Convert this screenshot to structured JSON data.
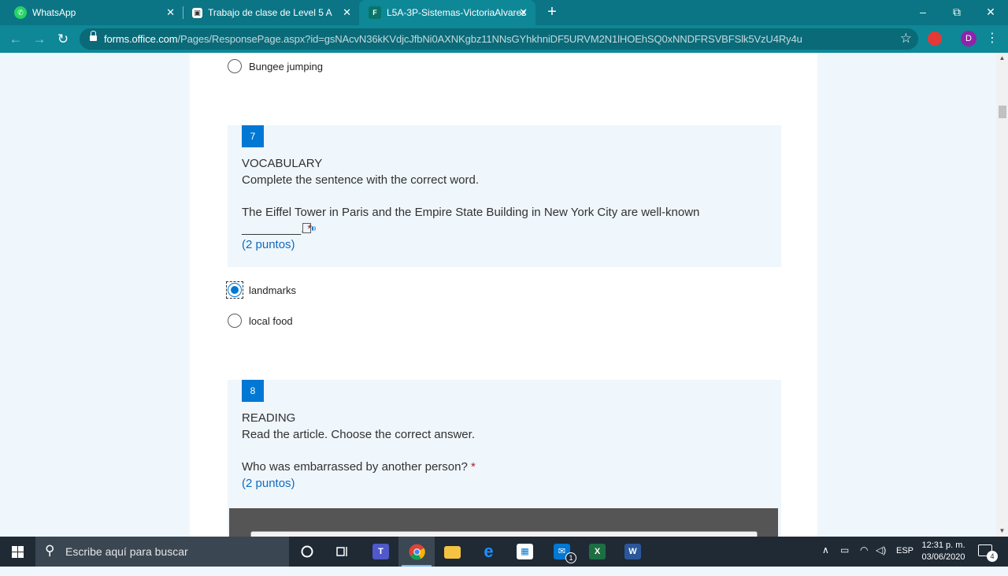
{
  "browser": {
    "tabs": [
      {
        "title": "WhatsApp",
        "icon": "whatsapp-icon"
      },
      {
        "title": "Trabajo de clase de Level 5 A",
        "icon": "classroom-icon"
      },
      {
        "title": "L5A-3P-Sistemas-VictoriaAlvarez",
        "icon": "forms-icon",
        "active": true
      }
    ],
    "new_tab": "+",
    "window": {
      "minimize": "–",
      "restore": "⧉",
      "close": "✕"
    },
    "url_domain": "forms.office.com",
    "url_path": "/Pages/ResponsePage.aspx?id=gsNAcvN36kKVdjcJfbNi0AXNKgbz11NNsGYhkhniDF5URVM2N1lHOEhSQ0xNNDFRSVBFSlk5VzU4Ry4u",
    "profile_initial": "D"
  },
  "form": {
    "prev_option": "Bungee jumping",
    "q7": {
      "number": "7",
      "section": "VOCABULARY",
      "instruction": "Complete the sentence with the correct word.",
      "sentence": "The Eiffel Tower in Paris and the Empire State Building in New York City are well-known",
      "blank": "_________.",
      "required_mark": "*",
      "points": "(2 puntos)",
      "options": [
        {
          "label": "landmarks",
          "checked": true
        },
        {
          "label": "local food",
          "checked": false
        }
      ]
    },
    "q8": {
      "number": "8",
      "section": "READING",
      "instruction": "Read the article. Choose the correct answer.",
      "question": "Who was embarrassed by another person?",
      "required_mark": "*",
      "points": "(2 puntos)"
    }
  },
  "taskbar": {
    "search_placeholder": "Escribe aquí para buscar",
    "apps": [
      "cortana-icon",
      "task-view-icon",
      "teams-icon",
      "chrome-icon",
      "file-explorer-icon",
      "edge-icon",
      "store-icon",
      "mail-icon",
      "excel-icon",
      "word-icon"
    ],
    "mail_badge": "1",
    "language": "ESP",
    "time": "12:31 p. m.",
    "date": "03/06/2020",
    "notifications": "4"
  },
  "colors": {
    "browser_chrome": "#0e8797",
    "accent": "#0078d4",
    "question_bg": "#eff6fc",
    "required": "#a4262c"
  }
}
